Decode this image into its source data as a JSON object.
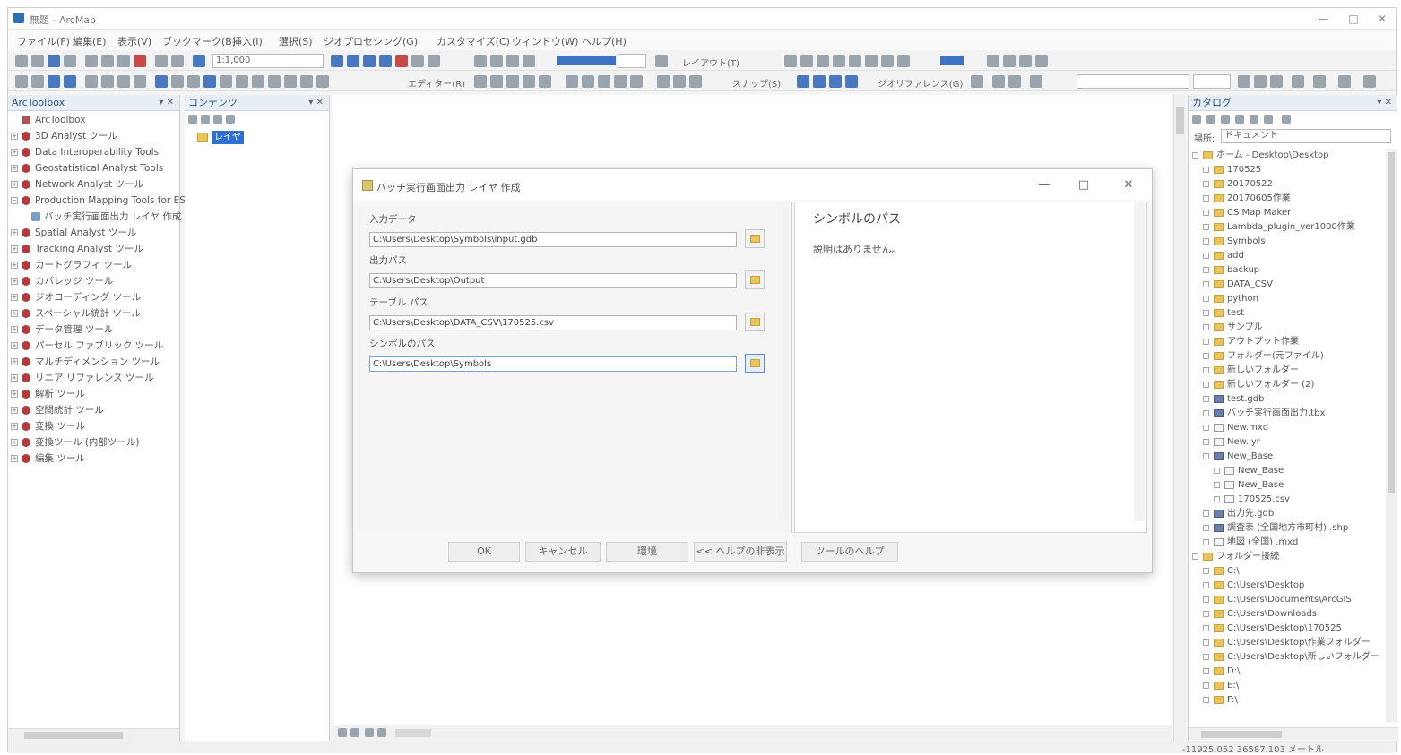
{
  "window": {
    "title": "無題 - ArcMap",
    "controls": [
      "—",
      "□",
      "✕"
    ]
  },
  "menubar": [
    "ファイル(F)",
    "編集(E)",
    "表示(V)",
    "ブックマーク(B)",
    "挿入(I)",
    "選択(S)",
    "ジオプロセシング(G)",
    "カスタマイズ(C)",
    "ウィンドウ(W)",
    "ヘルプ(H)"
  ],
  "toolbars": {
    "scale": "1:1,000",
    "editor_label": "エディター(R)",
    "snapping_label": "スナップ(S)",
    "georef_label": "ジオリファレンス(G)",
    "layout_label": "レイアウト(T)"
  },
  "toolbox": {
    "header": "ArcToolbox",
    "items": [
      {
        "label": "ArcToolbox",
        "exp": "",
        "icon": "box"
      },
      {
        "label": "3D Analyst ツール",
        "exp": "+",
        "icon": "tool"
      },
      {
        "label": "Data Interoperability Tools",
        "exp": "+",
        "icon": "tool"
      },
      {
        "label": "Geostatistical Analyst Tools",
        "exp": "+",
        "icon": "tool"
      },
      {
        "label": "Network Analyst ツール",
        "exp": "+",
        "icon": "tool"
      },
      {
        "label": "Production Mapping Tools for ESRI",
        "exp": "−",
        "icon": "tool"
      },
      {
        "label": "バッチ実行画面出力 レイヤ 作成",
        "exp": "",
        "icon": "script"
      },
      {
        "label": "Spatial Analyst ツール",
        "exp": "+",
        "icon": "tool"
      },
      {
        "label": "Tracking Analyst ツール",
        "exp": "+",
        "icon": "tool"
      },
      {
        "label": "カートグラフィ ツール",
        "exp": "+",
        "icon": "tool"
      },
      {
        "label": "カバレッジ ツール",
        "exp": "+",
        "icon": "tool"
      },
      {
        "label": "ジオコーディング ツール",
        "exp": "+",
        "icon": "tool"
      },
      {
        "label": "スペーシャル統計 ツール",
        "exp": "+",
        "icon": "tool"
      },
      {
        "label": "データ管理 ツール",
        "exp": "+",
        "icon": "tool"
      },
      {
        "label": "パーセル ファブリック ツール",
        "exp": "+",
        "icon": "tool"
      },
      {
        "label": "マルチディメンション ツール",
        "exp": "+",
        "icon": "tool"
      },
      {
        "label": "リニア リファレンス ツール",
        "exp": "+",
        "icon": "tool"
      },
      {
        "label": "解析 ツール",
        "exp": "+",
        "icon": "tool"
      },
      {
        "label": "空間統計 ツール",
        "exp": "+",
        "icon": "tool"
      },
      {
        "label": "変換 ツール",
        "exp": "+",
        "icon": "tool"
      },
      {
        "label": "変換ツール (内部ツール)",
        "exp": "+",
        "icon": "tool"
      },
      {
        "label": "編集 ツール",
        "exp": "+",
        "icon": "tool"
      }
    ]
  },
  "contents": {
    "header": "コンテンツ",
    "layer_label": "レイヤ"
  },
  "catalog": {
    "header": "カタログ",
    "location_label": "場所:",
    "location_value": "ドキュメント",
    "items": [
      {
        "label": "ホーム - Desktop\\Desktop",
        "indent": 0,
        "kind": "folder"
      },
      {
        "label": "170525",
        "indent": 1,
        "kind": "folder"
      },
      {
        "label": "20170522",
        "indent": 1,
        "kind": "folder"
      },
      {
        "label": "20170605作業",
        "indent": 1,
        "kind": "folder"
      },
      {
        "label": "CS Map Maker",
        "indent": 1,
        "kind": "folder"
      },
      {
        "label": "Lambda_plugin_ver1000作業",
        "indent": 1,
        "kind": "folder"
      },
      {
        "label": "Symbols",
        "indent": 1,
        "kind": "folder"
      },
      {
        "label": "add",
        "indent": 1,
        "kind": "folder"
      },
      {
        "label": "backup",
        "indent": 1,
        "kind": "folder"
      },
      {
        "label": "DATA_CSV",
        "indent": 1,
        "kind": "folder"
      },
      {
        "label": "python",
        "indent": 1,
        "kind": "folder"
      },
      {
        "label": "test",
        "indent": 1,
        "kind": "folder"
      },
      {
        "label": "サンプル",
        "indent": 1,
        "kind": "folder"
      },
      {
        "label": "アウトプット作業",
        "indent": 1,
        "kind": "folder"
      },
      {
        "label": "フォルダー(元ファイル)",
        "indent": 1,
        "kind": "folder"
      },
      {
        "label": "新しいフォルダー",
        "indent": 1,
        "kind": "folder"
      },
      {
        "label": "新しいフォルダー (2)",
        "indent": 1,
        "kind": "folder"
      },
      {
        "label": "test.gdb",
        "indent": 1,
        "kind": "db"
      },
      {
        "label": "バッチ実行画面出力.tbx",
        "indent": 1,
        "kind": "db"
      },
      {
        "label": "New.mxd",
        "indent": 1,
        "kind": "tbl"
      },
      {
        "label": "New.lyr",
        "indent": 1,
        "kind": "tbl"
      },
      {
        "label": "New_Base",
        "indent": 1,
        "kind": "db"
      },
      {
        "label": "New_Base",
        "indent": 2,
        "kind": "tbl"
      },
      {
        "label": "New_Base",
        "indent": 2,
        "kind": "tbl"
      },
      {
        "label": "170525.csv",
        "indent": 2,
        "kind": "tbl"
      },
      {
        "label": "出力先.gdb",
        "indent": 1,
        "kind": "db"
      },
      {
        "label": "調査表 (全国地方市町村) .shp",
        "indent": 1,
        "kind": "db"
      },
      {
        "label": "地図 (全国) .mxd",
        "indent": 1,
        "kind": "tbl"
      },
      {
        "label": "フォルダー接続",
        "indent": 0,
        "kind": "folder"
      },
      {
        "label": "C:\\",
        "indent": 1,
        "kind": "folder"
      },
      {
        "label": "C:\\Users\\Desktop",
        "indent": 1,
        "kind": "folder"
      },
      {
        "label": "C:\\Users\\Documents\\ArcGIS",
        "indent": 1,
        "kind": "folder"
      },
      {
        "label": "C:\\Users\\Downloads",
        "indent": 1,
        "kind": "folder"
      },
      {
        "label": "C:\\Users\\Desktop\\170525",
        "indent": 1,
        "kind": "folder"
      },
      {
        "label": "C:\\Users\\Desktop\\作業フォルダー",
        "indent": 1,
        "kind": "folder"
      },
      {
        "label": "C:\\Users\\Desktop\\新しいフォルダー",
        "indent": 1,
        "kind": "folder"
      },
      {
        "label": "D:\\",
        "indent": 1,
        "kind": "folder"
      },
      {
        "label": "E:\\",
        "indent": 1,
        "kind": "folder"
      },
      {
        "label": "F:\\",
        "indent": 1,
        "kind": "folder"
      }
    ]
  },
  "statusbar": {
    "coords": "-11925.052  36587.103 メートル"
  },
  "dialog": {
    "title": "バッチ実行画面出力 レイヤ 作成",
    "params": [
      {
        "label": "入力データ",
        "value": "C:\\Users\\Desktop\\Symbols\\input.gdb"
      },
      {
        "label": "出力パス",
        "value": "C:\\Users\\Desktop\\Output"
      },
      {
        "label": "テーブル パス",
        "value": "C:\\Users\\Desktop\\DATA_CSV\\170525.csv"
      },
      {
        "label": "シンボルのパス",
        "value": "C:\\Users\\Desktop\\Symbols"
      }
    ],
    "help_title": "シンボルのパス",
    "help_body": "説明はありません。",
    "buttons": [
      "OK",
      "キャンセル",
      "環境",
      "<< ヘルプの非表示",
      "ツールのヘルプ"
    ]
  }
}
